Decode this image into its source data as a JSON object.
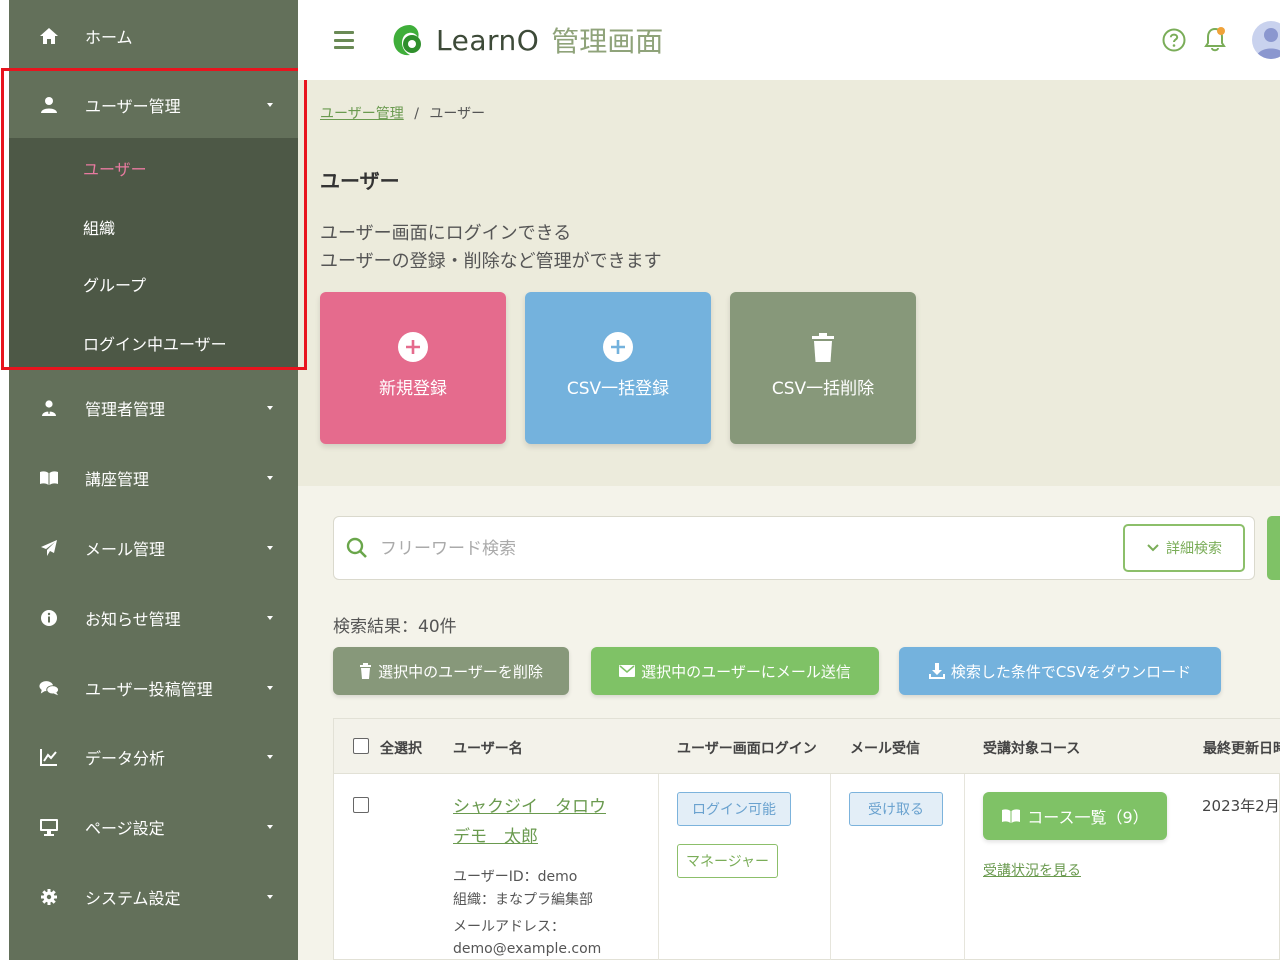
{
  "sidebar": {
    "items": [
      {
        "label": "ホーム",
        "icon": "home-icon"
      },
      {
        "label": "ユーザー管理",
        "icon": "user-icon"
      },
      {
        "label": "管理者管理",
        "icon": "admin-icon"
      },
      {
        "label": "講座管理",
        "icon": "book-icon"
      },
      {
        "label": "メール管理",
        "icon": "send-icon"
      },
      {
        "label": "お知らせ管理",
        "icon": "info-icon"
      },
      {
        "label": "ユーザー投稿管理",
        "icon": "comments-icon"
      },
      {
        "label": "データ分析",
        "icon": "chart-icon"
      },
      {
        "label": "ページ設定",
        "icon": "monitor-icon"
      },
      {
        "label": "システム設定",
        "icon": "gear-icon"
      }
    ],
    "submenu": [
      "ユーザー",
      "組織",
      "グループ",
      "ログイン中ユーザー"
    ]
  },
  "header": {
    "logo": "LearnO",
    "subtitle": "管理画面"
  },
  "breadcrumb": {
    "parent": "ユーザー管理",
    "separator": "/",
    "current": "ユーザー"
  },
  "page": {
    "title": "ユーザー",
    "desc_line1": "ユーザー画面にログインできる",
    "desc_line2": "ユーザーの登録・削除など管理ができます"
  },
  "actions": {
    "new": "新規登録",
    "csv_register": "CSV一括登録",
    "csv_delete": "CSV一括削除"
  },
  "search": {
    "placeholder": "フリーワード検索",
    "detail": "詳細検索"
  },
  "results": {
    "count_text": "検索結果：40件",
    "delete_selected": "選択中のユーザーを削除",
    "mail_selected": "選択中のユーザーにメール送信",
    "download_csv": "検索した条件でCSVをダウンロード"
  },
  "table": {
    "headers": {
      "select_all": "全選択",
      "user_name": "ユーザー名",
      "login": "ユーザー画面ログイン",
      "mail": "メール受信",
      "courses": "受講対象コース",
      "updated": "最終更新日時"
    },
    "rows": [
      {
        "kana": "シャクジイ　タロウ",
        "name": "デモ　太郎",
        "user_id": "ユーザーID：demo",
        "org": "組織：まなプラ編集部",
        "email_label": "メールアドレス：",
        "email": "demo@example.com",
        "login_status": "ログイン可能",
        "role": "マネージャー",
        "mail_status": "受け取る",
        "course_button": "コース一覧（9）",
        "progress_link": "受講状況を見る",
        "updated": "2023年2月"
      }
    ]
  },
  "colors": {
    "sidebar": "#63705a",
    "sidebar_sub": "#4d5846",
    "accent_green": "#7fc266",
    "pink": "#e56b8d",
    "blue": "#74b2dd",
    "gray_green": "#87987a",
    "highlight": "#e8141e"
  }
}
